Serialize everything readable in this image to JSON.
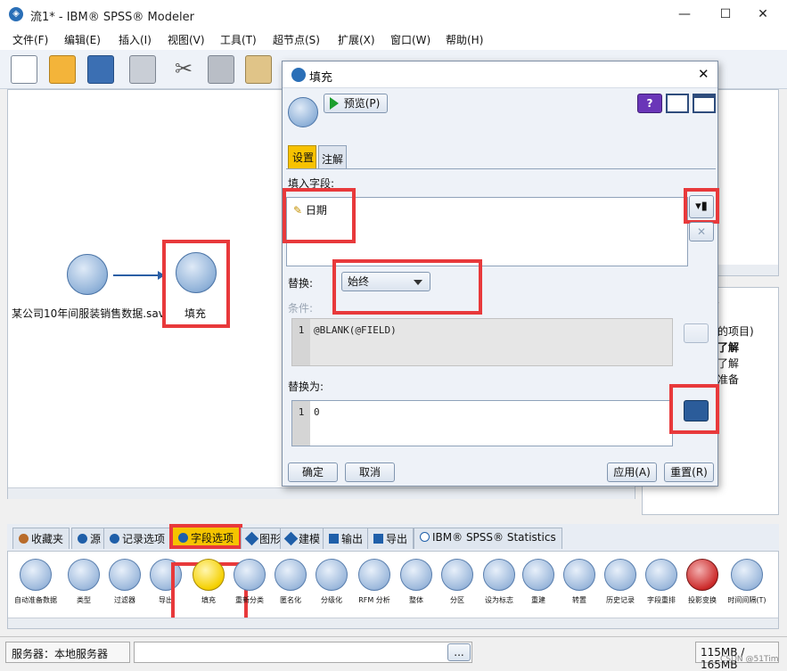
{
  "window": {
    "title": "流1* - IBM® SPSS® Modeler",
    "min_glyph": "—",
    "max_glyph": "☐",
    "close_glyph": "✕"
  },
  "menu": [
    "文件(F)",
    "编辑(E)",
    "插入(I)",
    "视图(V)",
    "工具(T)",
    "超节点(S)",
    "扩展(X)",
    "窗口(W)",
    "帮助(H)"
  ],
  "toolbar": {
    "icons": [
      "new-file-icon",
      "open-folder-icon",
      "save-icon",
      "print-icon",
      "cut-icon",
      "copy-icon",
      "paste-icon"
    ]
  },
  "canvas": {
    "nodes": [
      {
        "label": "某公司10年间服装销售数据.sav",
        "icon": "source-file-node-icon"
      },
      {
        "label": "填充",
        "icon": "filler-node-icon"
      }
    ]
  },
  "right_panel": {
    "lines": [
      "的项目)",
      "了解",
      "了解",
      "准备"
    ],
    "tab_label": "象"
  },
  "dialog": {
    "title": "填充",
    "preview_label": "预览(P)",
    "tabs": [
      "设置",
      "注解"
    ],
    "fill_fields_label": "填入字段:",
    "fill_field_value": "日期",
    "replace_label": "替换:",
    "replace_value": "始终",
    "condition_label": "条件:",
    "condition_code": "@BLANK(@FIELD)",
    "condition_line": "1",
    "replace_with_label": "替换为:",
    "replace_with_code": "0",
    "replace_with_line": "1",
    "buttons": {
      "ok": "确定",
      "cancel": "取消",
      "apply": "应用(A)",
      "reset": "重置(R)"
    },
    "help_glyph": "?"
  },
  "palette_tabs": [
    {
      "label": "收藏夹",
      "active": false
    },
    {
      "label": "源",
      "active": false
    },
    {
      "label": "记录选项",
      "active": false
    },
    {
      "label": "字段选项",
      "active": true
    },
    {
      "label": "图形",
      "active": false
    },
    {
      "label": "建模",
      "active": false
    },
    {
      "label": "输出",
      "active": false
    },
    {
      "label": "导出",
      "active": false
    },
    {
      "label": "IBM® SPSS® Statistics",
      "active": false
    }
  ],
  "palette_nodes": [
    "自动准备数据",
    "类型",
    "过滤器",
    "导出",
    "填充",
    "重新分类",
    "匿名化",
    "分级化",
    "RFM 分析",
    "整体",
    "分区",
    "设为标志",
    "重建",
    "转置",
    "历史记录",
    "字段重排",
    "投影变换",
    "时间间隔(T)"
  ],
  "status": {
    "server": "服务器：本地服务器",
    "ellipsis": "...",
    "memory": "115MB / 165MB",
    "watermark": "CSDN @51Tim"
  },
  "colors": {
    "highlight": "#e8393b",
    "active_tab": "#f5c400",
    "node_blue": "#2a5fa5"
  }
}
